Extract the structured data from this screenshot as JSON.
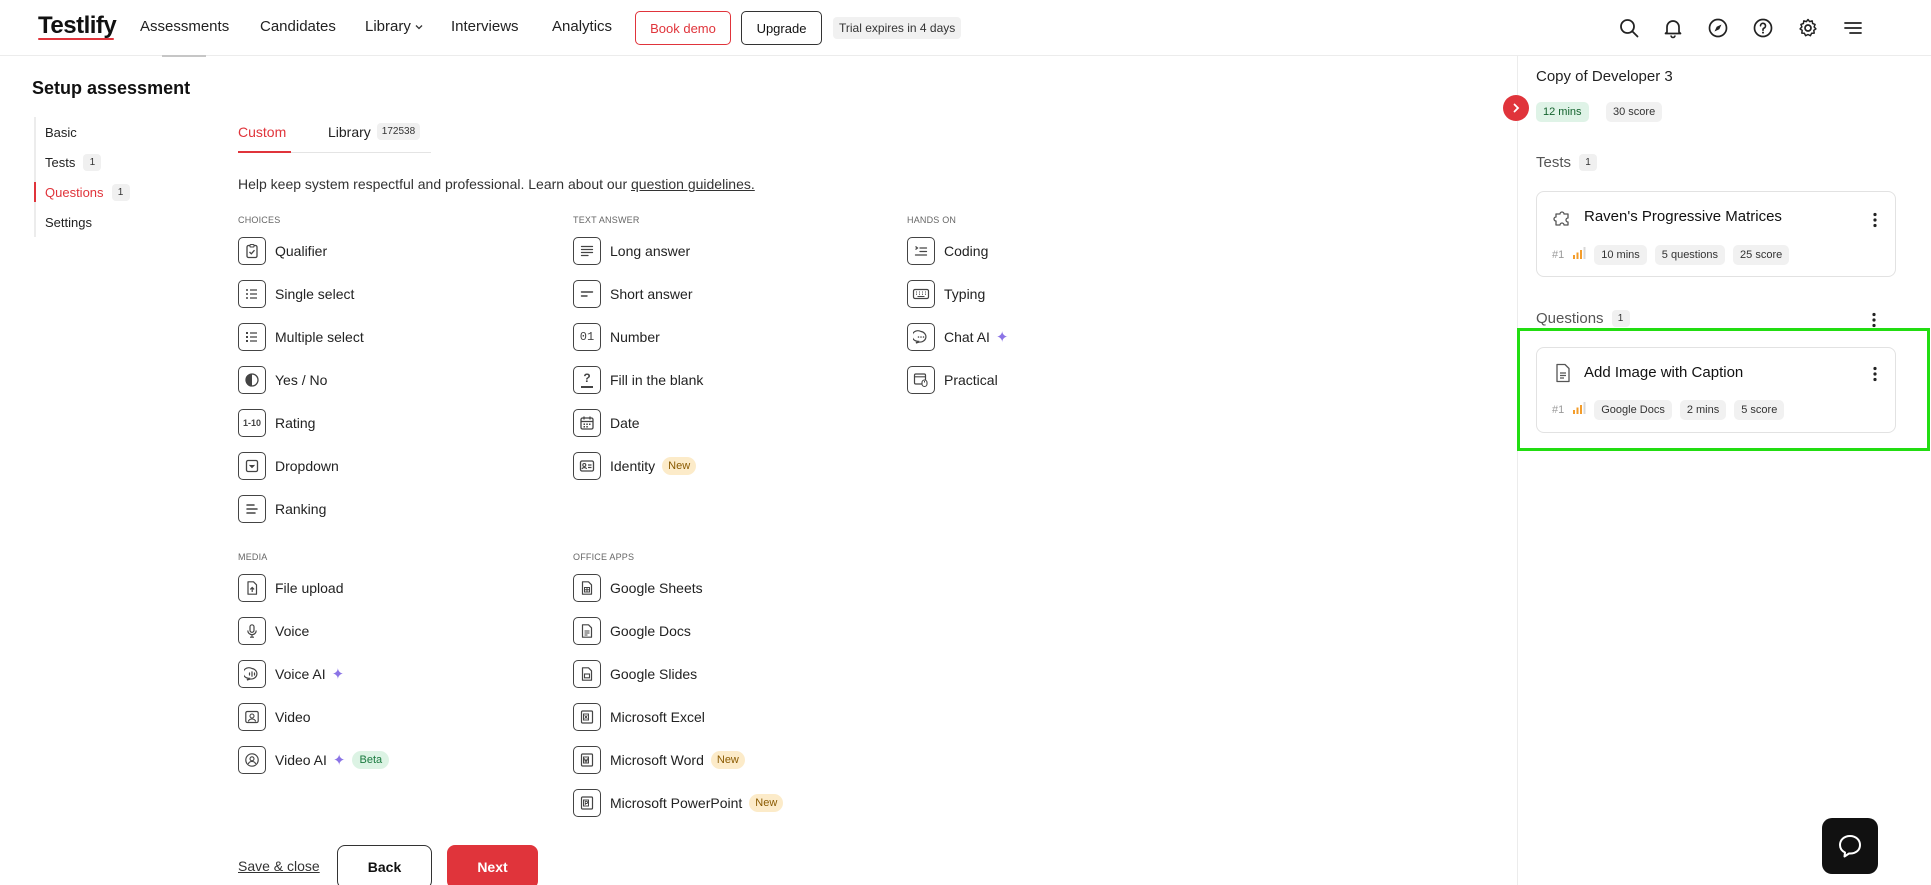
{
  "brand": {
    "name": "Testlify",
    "accent": "#e0343b"
  },
  "nav": {
    "links": [
      "Assessments",
      "Candidates",
      "Library",
      "Interviews",
      "Analytics"
    ],
    "book_demo": "Book demo",
    "upgrade": "Upgrade",
    "trial": "Trial expires in 4 days",
    "icons": [
      "search-icon",
      "bell-icon",
      "compass-icon",
      "help-icon",
      "gear-icon",
      "menu-icon"
    ]
  },
  "page_title": "Setup assessment",
  "sidebar": {
    "items": [
      {
        "label": "Basic",
        "count": ""
      },
      {
        "label": "Tests",
        "count": "1"
      },
      {
        "label": "Questions",
        "count": "1"
      },
      {
        "label": "Settings",
        "count": ""
      }
    ]
  },
  "tabs": {
    "custom": "Custom",
    "library": "Library",
    "library_count": "172538"
  },
  "help": {
    "text": "Help keep system respectful and professional. Learn about our ",
    "link": "question guidelines."
  },
  "sections": {
    "choices": "CHOICES",
    "text_answer": "TEXT ANSWER",
    "hands_on": "HANDS ON",
    "media": "MEDIA",
    "office_apps": "OFFICE APPS"
  },
  "question_types": {
    "choices": [
      "Qualifier",
      "Single select",
      "Multiple select",
      "Yes / No",
      "Rating",
      "Dropdown",
      "Ranking"
    ],
    "text_answer": [
      "Long answer",
      "Short answer",
      "Number",
      "Fill in the blank",
      "Date",
      "Identity"
    ],
    "hands_on": [
      "Coding",
      "Typing",
      "Chat AI",
      "Practical"
    ],
    "media": [
      "File upload",
      "Voice",
      "Voice AI",
      "Video",
      "Video AI"
    ],
    "office_apps": [
      "Google Sheets",
      "Google Docs",
      "Google Slides",
      "Microsoft Excel",
      "Microsoft Word",
      "Microsoft PowerPoint"
    ]
  },
  "icon_text": {
    "number": "01",
    "rating": "1-10",
    "fill_blank": "?"
  },
  "tags": {
    "new": "New",
    "beta": "Beta"
  },
  "footer": {
    "save_close": "Save & close",
    "back": "Back",
    "next": "Next"
  },
  "right_panel": {
    "title": "Copy of Developer 3",
    "duration": "12 mins",
    "score": "30 score",
    "tests_label": "Tests",
    "tests_count": "1",
    "test_card": {
      "title": "Raven's Progressive Matrices",
      "num": "#1",
      "mins": "10 mins",
      "questions": "5 questions",
      "score": "25 score"
    },
    "questions_label": "Questions",
    "questions_count": "1",
    "question_card": {
      "title": "Add Image with Caption",
      "num": "#1",
      "type": "Google Docs",
      "mins": "2 mins",
      "score": "5 score"
    }
  }
}
